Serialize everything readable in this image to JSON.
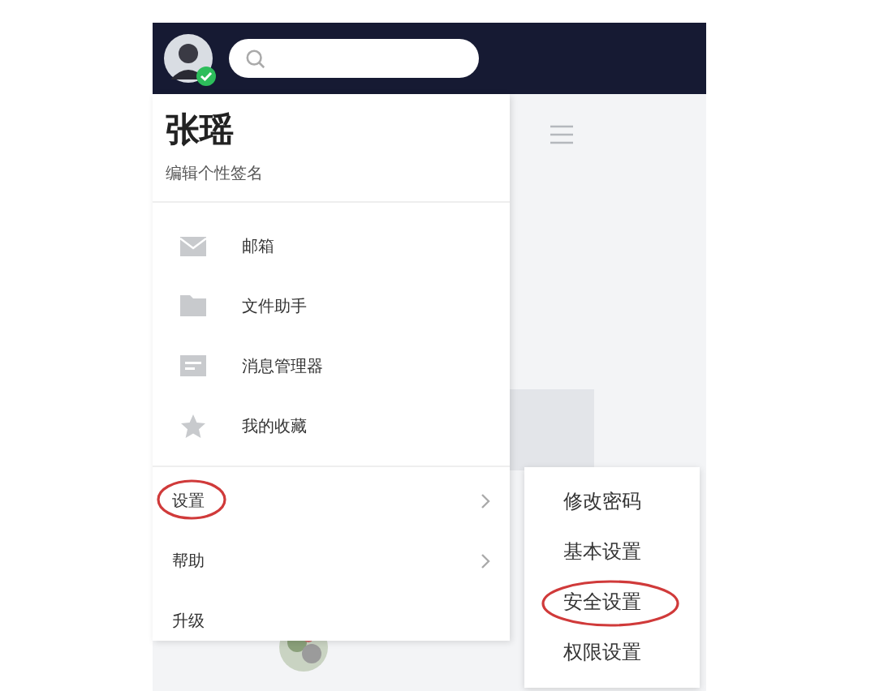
{
  "profile": {
    "name": "张瑶",
    "signature": "编辑个性签名"
  },
  "tools": [
    {
      "label": "邮箱"
    },
    {
      "label": "文件助手"
    },
    {
      "label": "消息管理器"
    },
    {
      "label": "我的收藏"
    }
  ],
  "menu": [
    {
      "label": "设置",
      "kind": "submenu",
      "circled": true
    },
    {
      "label": "帮助",
      "kind": "submenu",
      "circled": false
    },
    {
      "label": "升级",
      "kind": "plain",
      "circled": false
    }
  ],
  "submenu": [
    {
      "label": "修改密码",
      "circled": false
    },
    {
      "label": "基本设置",
      "circled": false
    },
    {
      "label": "安全设置",
      "circled": true
    },
    {
      "label": "权限设置",
      "circled": false
    }
  ]
}
